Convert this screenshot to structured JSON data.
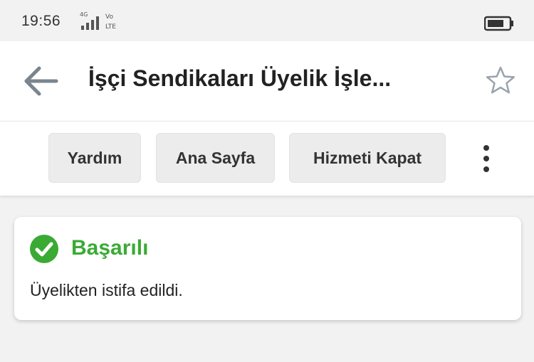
{
  "status_bar": {
    "time": "19:56",
    "signal_icon": "signal-bars-icon",
    "network_label": "LTE",
    "battery_icon": "battery-icon"
  },
  "app_bar": {
    "back_icon": "arrow-left-icon",
    "title": "İşçi Sendikaları Üyelik İşle...",
    "bookmark_icon": "star-outline-icon"
  },
  "toolbar": {
    "buttons": [
      {
        "label": "Yardım"
      },
      {
        "label": "Ana Sayfa"
      },
      {
        "label": "Hizmeti Kapat"
      }
    ],
    "more_icon": "vertical-dots-icon"
  },
  "result": {
    "status_icon": "check-circle-icon",
    "title": "Başarılı",
    "message": "Üyelikten istifa edildi.",
    "accent_color": "#3aaa35"
  }
}
